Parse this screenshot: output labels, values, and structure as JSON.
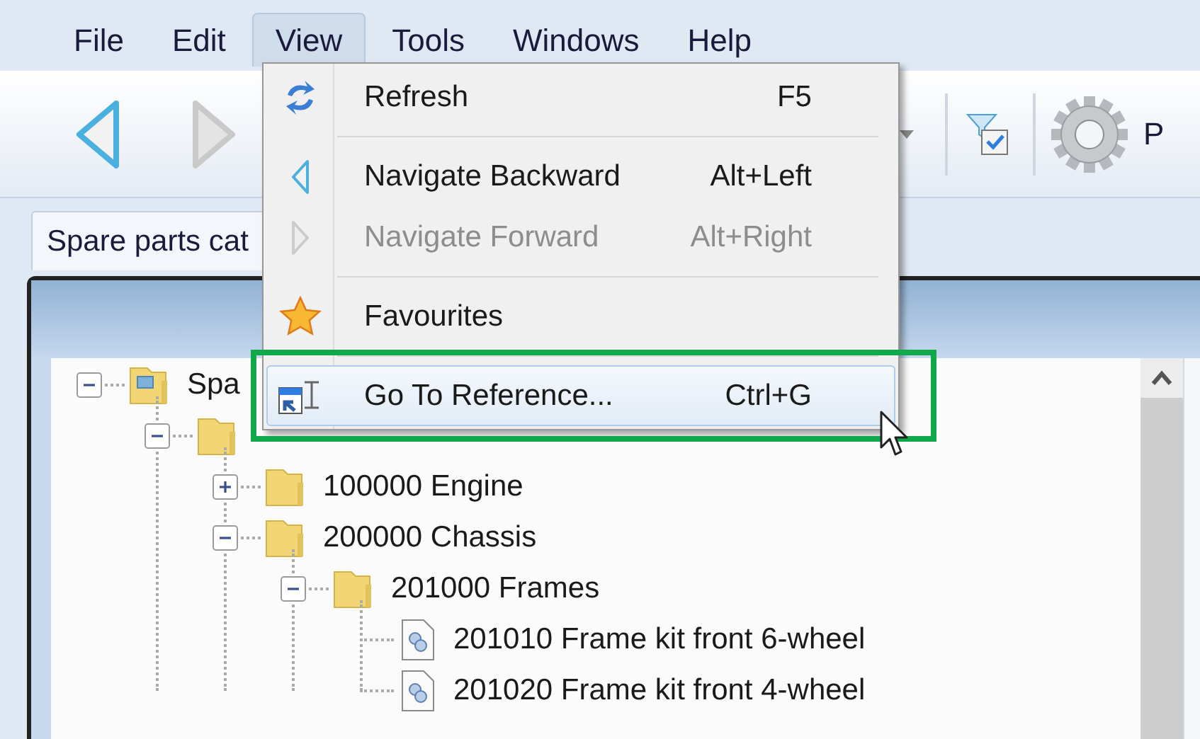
{
  "menu_bar": [
    {
      "label": "File",
      "selected": false
    },
    {
      "label": "Edit",
      "selected": false
    },
    {
      "label": "View",
      "selected": true
    },
    {
      "label": "Tools",
      "selected": false
    },
    {
      "label": "Windows",
      "selected": false
    },
    {
      "label": "Help",
      "selected": false
    }
  ],
  "toolbar": {
    "cut_label": "P"
  },
  "tab": {
    "label": "Spare parts cat"
  },
  "view_menu": [
    {
      "kind": "item",
      "label": "Refresh",
      "shortcut": "F5",
      "disabled": false,
      "selected": false
    },
    {
      "kind": "separator"
    },
    {
      "kind": "item",
      "label": "Navigate Backward",
      "shortcut": "Alt+Left",
      "disabled": false,
      "selected": false
    },
    {
      "kind": "item",
      "label": "Navigate Forward",
      "shortcut": "Alt+Right",
      "disabled": true,
      "selected": false
    },
    {
      "kind": "separator"
    },
    {
      "kind": "item",
      "label": "Favourites",
      "disabled": false,
      "selected": false
    },
    {
      "kind": "separator"
    },
    {
      "kind": "item",
      "label": "Go To Reference...",
      "shortcut": "Ctrl+G",
      "disabled": false,
      "selected": true
    }
  ],
  "tree": [
    {
      "kind": "root",
      "label": "Spa",
      "expanded": true,
      "children": [
        {
          "kind": "folder",
          "expanded": true,
          "children": [
            {
              "kind": "folder",
              "label": "100000 Engine",
              "expanded": false
            },
            {
              "kind": "folder",
              "label": "200000 Chassis",
              "expanded": true,
              "children": [
                {
                  "kind": "folder",
                  "label": "201000 Frames",
                  "expanded": true,
                  "children": [
                    {
                      "kind": "part",
                      "label": "201010 Frame kit front 6-wheel"
                    },
                    {
                      "kind": "part",
                      "label": "201020 Frame kit front 4-wheel"
                    }
                  ]
                }
              ]
            }
          ]
        }
      ]
    }
  ]
}
